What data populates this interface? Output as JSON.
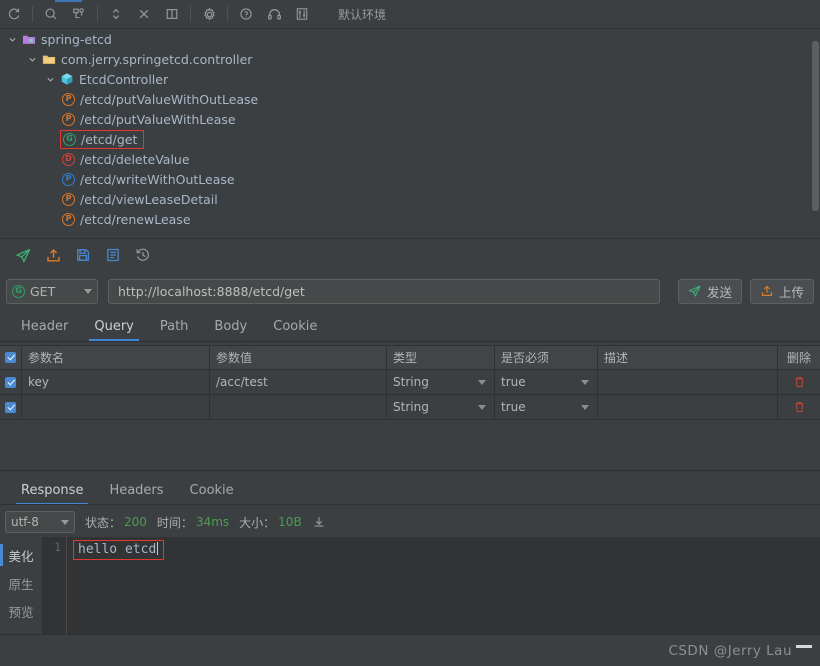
{
  "toolbar": {
    "icons": [
      {
        "name": "refresh-icon",
        "title": "refresh"
      },
      {
        "name": "search-icon",
        "title": "search"
      },
      {
        "name": "tree-node-icon",
        "title": "structure"
      },
      {
        "name": "expand-collapse-icon",
        "title": "expand"
      },
      {
        "name": "close-icon",
        "title": "close"
      },
      {
        "name": "split-panel-icon",
        "title": "split"
      },
      {
        "name": "gear-icon",
        "title": "settings"
      },
      {
        "name": "help-icon",
        "title": "help"
      },
      {
        "name": "headset-icon",
        "title": "support"
      },
      {
        "name": "sliders-icon",
        "title": "filters"
      }
    ],
    "environment": "默认环境"
  },
  "tree": {
    "root": {
      "label": "spring-etcd",
      "icon": "module-icon",
      "expanded": true
    },
    "package": {
      "label": "com.jerry.springetcd.controller",
      "icon": "folder-icon",
      "expanded": true
    },
    "controller": {
      "label": "EtcdController",
      "icon": "class-cube-icon",
      "expanded": true
    },
    "endpoints": [
      {
        "label": "/etcd/putValueWithOutLease",
        "method": "P",
        "color": "orange",
        "selected": false
      },
      {
        "label": "/etcd/putValueWithLease",
        "method": "P",
        "color": "orange",
        "selected": false
      },
      {
        "label": "/etcd/get",
        "method": "G",
        "color": "green",
        "selected": true
      },
      {
        "label": "/etcd/deleteValue",
        "method": "D",
        "color": "red",
        "selected": false
      },
      {
        "label": "/etcd/writeWithOutLease",
        "method": "P",
        "color": "blue",
        "selected": false
      },
      {
        "label": "/etcd/viewLeaseDetail",
        "method": "P",
        "color": "orange",
        "selected": false
      },
      {
        "label": "/etcd/renewLease",
        "method": "P",
        "color": "orange",
        "selected": false
      }
    ]
  },
  "actions": [
    {
      "name": "send-icon",
      "title": "send"
    },
    {
      "name": "upload-icon",
      "title": "upload"
    },
    {
      "name": "save-icon",
      "title": "save"
    },
    {
      "name": "document-icon",
      "title": "doc"
    },
    {
      "name": "history-icon",
      "title": "history"
    }
  ],
  "request": {
    "method": "GET",
    "method_badge": "G",
    "url": "http://localhost:8888/etcd/get",
    "send_label": "发送",
    "upload_label": "上传",
    "tabs": [
      {
        "label": "Header",
        "active": false
      },
      {
        "label": "Query",
        "active": true
      },
      {
        "label": "Path",
        "active": false
      },
      {
        "label": "Body",
        "active": false
      },
      {
        "label": "Cookie",
        "active": false
      }
    ]
  },
  "params": {
    "headers": [
      "参数名",
      "参数值",
      "类型",
      "是否必须",
      "描述",
      "删除"
    ],
    "rows": [
      {
        "checked": true,
        "name": "key",
        "value": "/acc/test",
        "type": "String",
        "required": "true",
        "desc": ""
      },
      {
        "checked": true,
        "name": "",
        "value": "",
        "type": "String",
        "required": "true",
        "desc": ""
      }
    ]
  },
  "response": {
    "tabs": [
      {
        "label": "Response",
        "active": true
      },
      {
        "label": "Headers",
        "active": false
      },
      {
        "label": "Cookie",
        "active": false
      }
    ],
    "encoding": "utf-8",
    "status_label": "状态：",
    "status_value": "200",
    "time_label": "时间：",
    "time_value": "34ms",
    "size_label": "大小：",
    "size_value": "10B",
    "download_icon": "download-icon",
    "side_tabs": [
      {
        "label": "美化",
        "active": true
      },
      {
        "label": "原生",
        "active": false
      },
      {
        "label": "预览",
        "active": false
      }
    ],
    "line_number": "1",
    "body_text": "hello etcd"
  },
  "footer": {
    "watermark": "CSDN @Jerry Lau"
  },
  "colors": {
    "background": "#3c3f41",
    "editor_bg": "#313335",
    "accent_blue": "#3f86d6",
    "status_green": "#4d9b53",
    "highlight_red": "#e03a30",
    "text": "#a9b7c6"
  }
}
